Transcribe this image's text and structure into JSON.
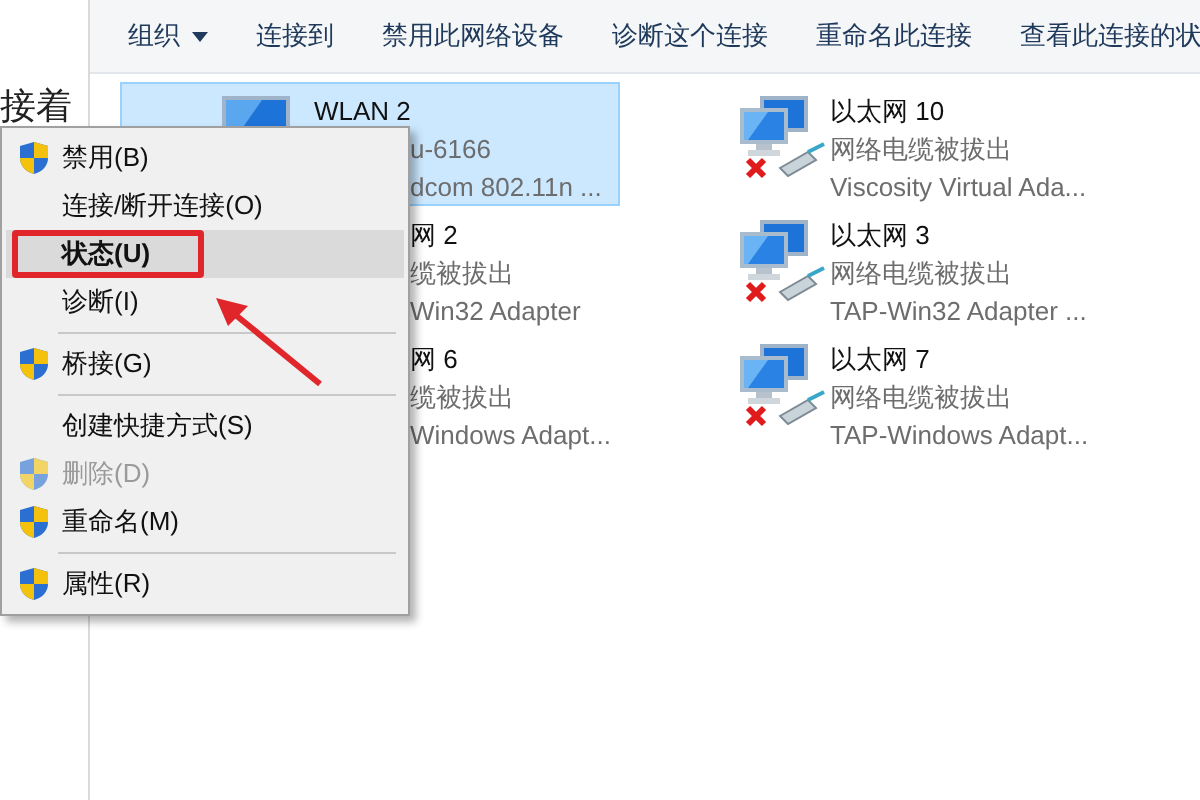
{
  "side_panel": {
    "text": "接着"
  },
  "toolbar": [
    {
      "label": "组织",
      "dropdown": true
    },
    {
      "label": "连接到",
      "dropdown": false
    },
    {
      "label": "禁用此网络设备",
      "dropdown": false
    },
    {
      "label": "诊断这个连接",
      "dropdown": false
    },
    {
      "label": "重命名此连接",
      "dropdown": false
    },
    {
      "label": "查看此连接的状",
      "dropdown": false
    }
  ],
  "connections": [
    {
      "name": "WLAN 2",
      "status": "u-6166",
      "device": "dcom 802.11n ...",
      "kind": "wireless",
      "selected": true,
      "disconnected": false
    },
    {
      "name": "以太网 10",
      "status": "网络电缆被拔出",
      "device": "Viscosity Virtual Ada...",
      "kind": "ethernet",
      "selected": false,
      "disconnected": true
    },
    {
      "name": "网 2",
      "status": "缆被拔出",
      "device": "Win32 Adapter",
      "selected": false
    },
    {
      "name": "以太网 3",
      "status": "网络电缆被拔出",
      "device": "TAP-Win32 Adapter ...",
      "kind": "ethernet",
      "selected": false,
      "disconnected": true
    },
    {
      "name": "网 6",
      "status": "缆被拔出",
      "device": "Windows Adapt...",
      "selected": false
    },
    {
      "name": "以太网 7",
      "status": "网络电缆被拔出",
      "device": "TAP-Windows Adapt...",
      "kind": "ethernet",
      "selected": false,
      "disconnected": true
    }
  ],
  "context_menu": [
    {
      "kind": "command",
      "label": "禁用(B)",
      "shield": true,
      "bold": false,
      "selected": false,
      "disabled": false,
      "annotated": false
    },
    {
      "kind": "command",
      "label": "连接/断开连接(O)",
      "shield": false,
      "bold": false,
      "selected": false,
      "disabled": false,
      "annotated": false
    },
    {
      "kind": "command",
      "label": "状态(U)",
      "shield": false,
      "bold": true,
      "selected": true,
      "disabled": false,
      "annotated": true
    },
    {
      "kind": "command",
      "label": "诊断(I)",
      "shield": false,
      "bold": false,
      "selected": false,
      "disabled": false,
      "annotated": false
    },
    {
      "kind": "separator"
    },
    {
      "kind": "command",
      "label": "桥接(G)",
      "shield": true,
      "bold": false,
      "selected": false,
      "disabled": false,
      "annotated": false
    },
    {
      "kind": "separator"
    },
    {
      "kind": "command",
      "label": "创建快捷方式(S)",
      "shield": false,
      "bold": false,
      "selected": false,
      "disabled": false,
      "annotated": false
    },
    {
      "kind": "command",
      "label": "删除(D)",
      "shield": true,
      "bold": false,
      "selected": false,
      "disabled": true,
      "annotated": false
    },
    {
      "kind": "command",
      "label": "重命名(M)",
      "shield": true,
      "bold": false,
      "selected": false,
      "disabled": false,
      "annotated": false
    },
    {
      "kind": "separator"
    },
    {
      "kind": "command",
      "label": "属性(R)",
      "shield": true,
      "bold": false,
      "selected": false,
      "disabled": false,
      "annotated": false
    }
  ]
}
